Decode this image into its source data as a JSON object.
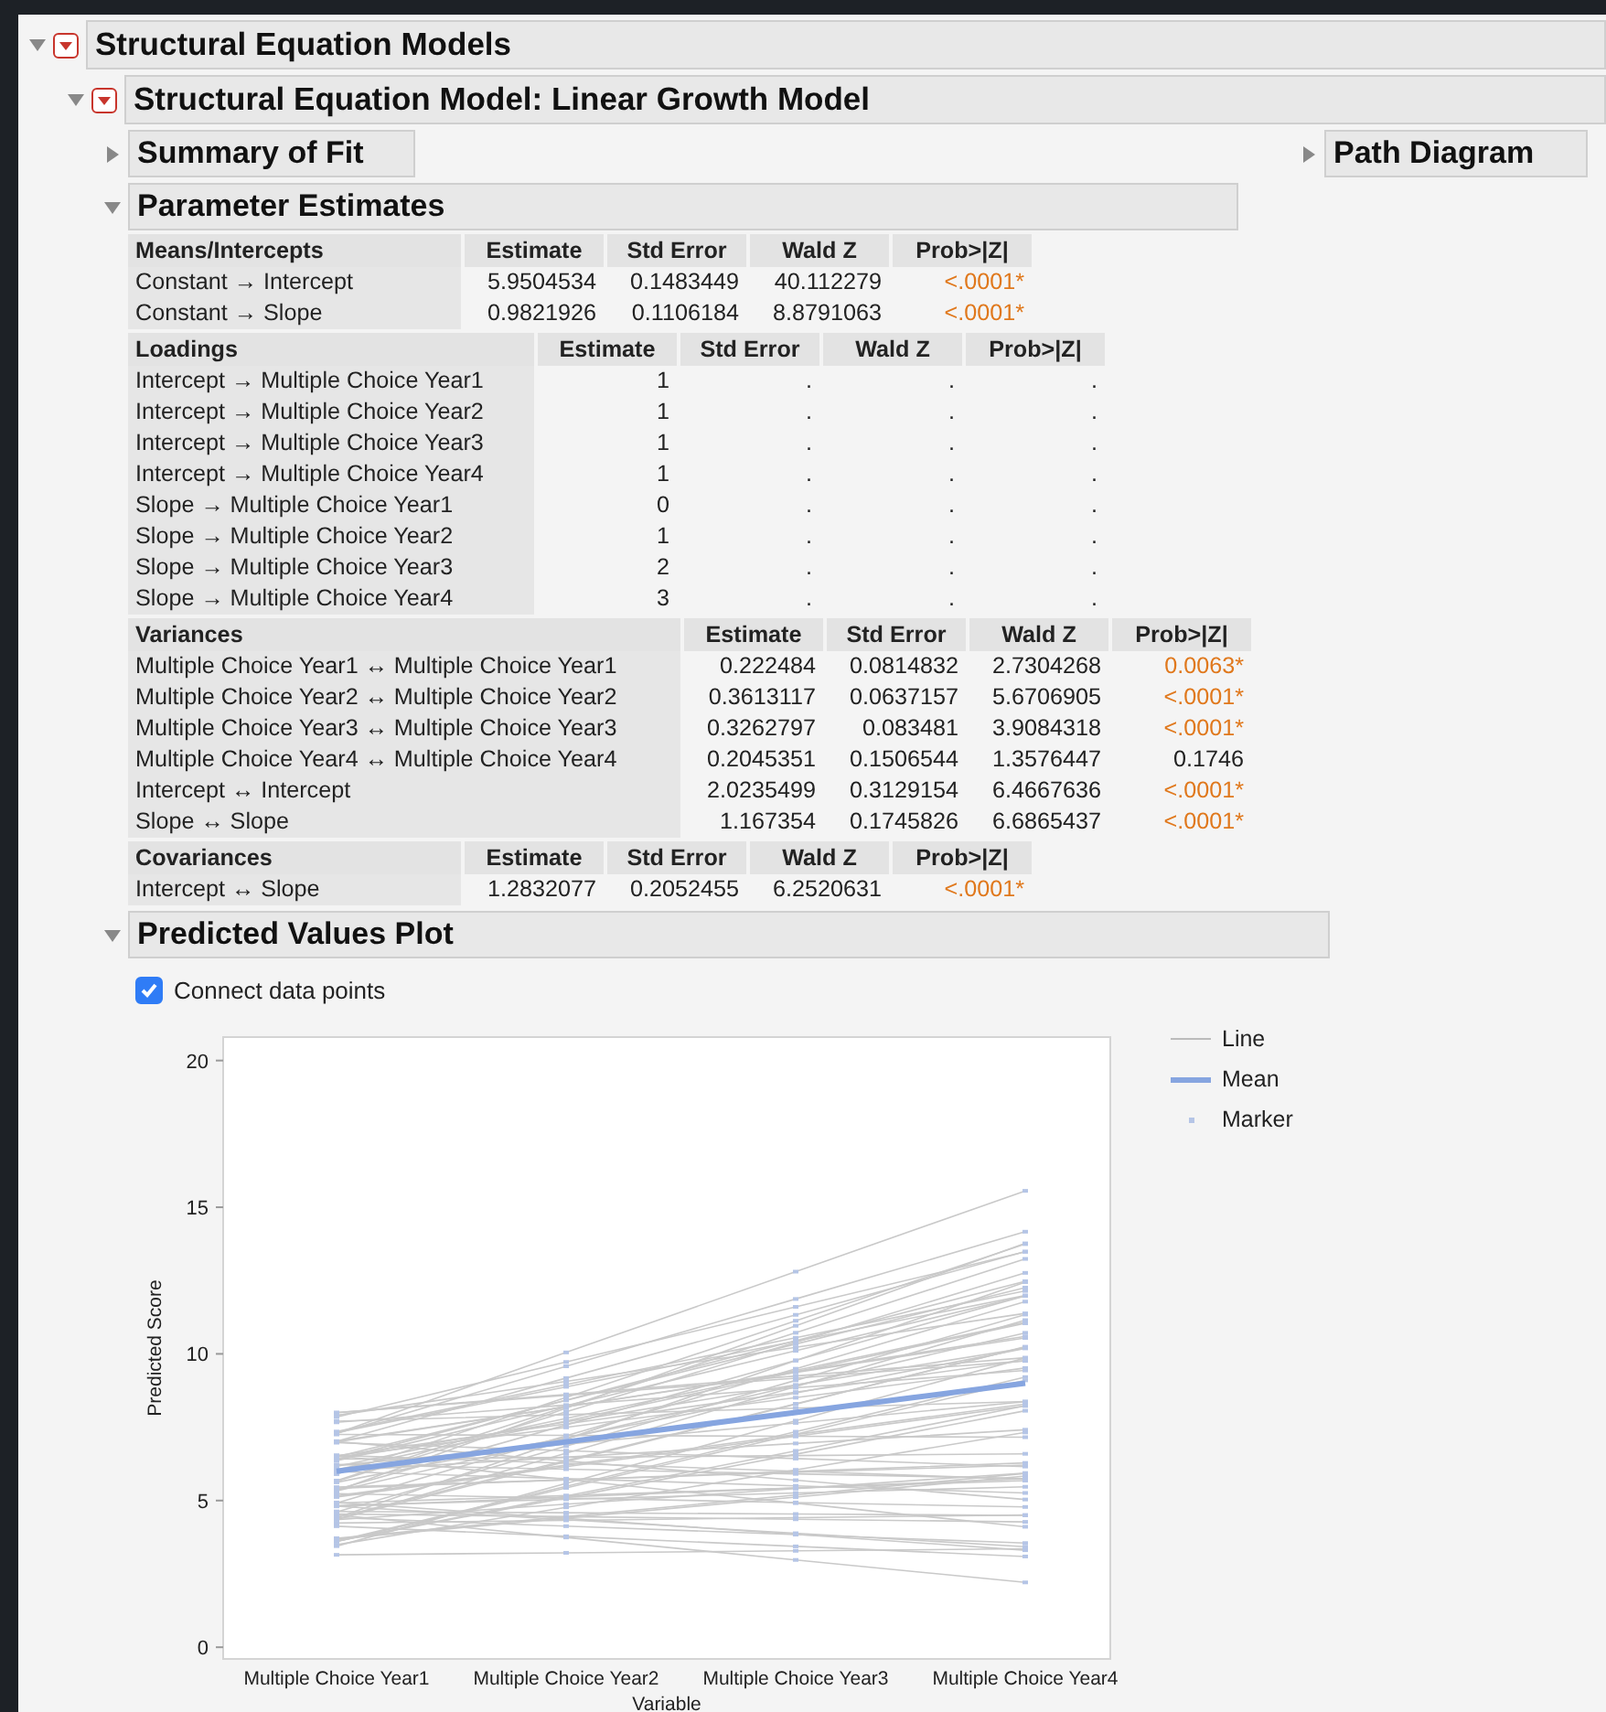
{
  "report": {
    "title": "Structural Equation Models",
    "expanded": true
  },
  "model": {
    "title": "Structural Equation Model: Linear Growth Model",
    "expanded": true
  },
  "summary_of_fit": {
    "title": "Summary of Fit",
    "expanded": false
  },
  "path_diagram": {
    "title": "Path Diagram",
    "expanded": false
  },
  "parameter_estimates": {
    "title": "Parameter Estimates",
    "expanded": true,
    "tables": [
      {
        "title": "Means/Intercepts",
        "columns": [
          "Estimate",
          "Std Error",
          "Wald Z",
          "Prob>|Z|"
        ],
        "rows": [
          {
            "label": "Constant → Intercept",
            "cells": [
              "5.9504534",
              "0.1483449",
              "40.112279"
            ],
            "prob": "<.0001*",
            "significant": true
          },
          {
            "label": "Constant → Slope",
            "cells": [
              "0.9821926",
              "0.1106184",
              "8.8791063"
            ],
            "prob": "<.0001*",
            "significant": true
          }
        ]
      },
      {
        "title": "Loadings",
        "columns": [
          "Estimate",
          "Std Error",
          "Wald Z",
          "Prob>|Z|"
        ],
        "rows": [
          {
            "label": "Intercept → Multiple Choice Year1",
            "cells": [
              "1",
              ".",
              "."
            ],
            "prob": ".",
            "significant": false
          },
          {
            "label": "Intercept → Multiple Choice Year2",
            "cells": [
              "1",
              ".",
              "."
            ],
            "prob": ".",
            "significant": false
          },
          {
            "label": "Intercept → Multiple Choice Year3",
            "cells": [
              "1",
              ".",
              "."
            ],
            "prob": ".",
            "significant": false
          },
          {
            "label": "Intercept → Multiple Choice Year4",
            "cells": [
              "1",
              ".",
              "."
            ],
            "prob": ".",
            "significant": false
          },
          {
            "label": "Slope → Multiple Choice Year1",
            "cells": [
              "0",
              ".",
              "."
            ],
            "prob": ".",
            "significant": false
          },
          {
            "label": "Slope → Multiple Choice Year2",
            "cells": [
              "1",
              ".",
              "."
            ],
            "prob": ".",
            "significant": false
          },
          {
            "label": "Slope → Multiple Choice Year3",
            "cells": [
              "2",
              ".",
              "."
            ],
            "prob": ".",
            "significant": false
          },
          {
            "label": "Slope → Multiple Choice Year4",
            "cells": [
              "3",
              ".",
              "."
            ],
            "prob": ".",
            "significant": false
          }
        ]
      },
      {
        "title": "Variances",
        "columns": [
          "Estimate",
          "Std Error",
          "Wald Z",
          "Prob>|Z|"
        ],
        "rows": [
          {
            "label": "Multiple Choice Year1 ↔ Multiple Choice Year1",
            "cells": [
              "0.222484",
              "0.0814832",
              "2.7304268"
            ],
            "prob": "0.0063*",
            "significant": true
          },
          {
            "label": "Multiple Choice Year2 ↔ Multiple Choice Year2",
            "cells": [
              "0.3613117",
              "0.0637157",
              "5.6706905"
            ],
            "prob": "<.0001*",
            "significant": true
          },
          {
            "label": "Multiple Choice Year3 ↔ Multiple Choice Year3",
            "cells": [
              "0.3262797",
              "0.083481",
              "3.9084318"
            ],
            "prob": "<.0001*",
            "significant": true
          },
          {
            "label": "Multiple Choice Year4 ↔ Multiple Choice Year4",
            "cells": [
              "0.2045351",
              "0.1506544",
              "1.3576447"
            ],
            "prob": "0.1746",
            "significant": false
          },
          {
            "label": "Intercept ↔ Intercept",
            "cells": [
              "2.0235499",
              "0.3129154",
              "6.4667636"
            ],
            "prob": "<.0001*",
            "significant": true
          },
          {
            "label": "Slope ↔ Slope",
            "cells": [
              "1.167354",
              "0.1745826",
              "6.6865437"
            ],
            "prob": "<.0001*",
            "significant": true
          }
        ]
      },
      {
        "title": "Covariances",
        "columns": [
          "Estimate",
          "Std Error",
          "Wald Z",
          "Prob>|Z|"
        ],
        "rows": [
          {
            "label": "Intercept ↔ Slope",
            "cells": [
              "1.2832077",
              "0.2052455",
              "6.2520631"
            ],
            "prob": "<.0001*",
            "significant": true
          }
        ]
      }
    ]
  },
  "predicted_values_plot": {
    "title": "Predicted Values Plot",
    "expanded": true,
    "connect_checkbox": {
      "label": "Connect data points",
      "checked": true
    },
    "legend": [
      {
        "kind": "line",
        "label": "Line"
      },
      {
        "kind": "series"
      },
      {
        "kind": "marker",
        "label": "Marker"
      }
    ],
    "chart_data": {
      "type": "line",
      "xlabel": "Variable",
      "ylabel": "Predicted Score",
      "categories": [
        "Multiple Choice Year1",
        "Multiple Choice Year2",
        "Multiple Choice Year3",
        "Multiple Choice Year4"
      ],
      "series": [
        {
          "name": "Mean",
          "color": "#86a5e0",
          "values": [
            6,
            7,
            8,
            9
          ]
        }
      ],
      "ylim": [
        -0.4,
        20.8
      ],
      "yticks": [
        0,
        5,
        10,
        15,
        20
      ]
    }
  }
}
